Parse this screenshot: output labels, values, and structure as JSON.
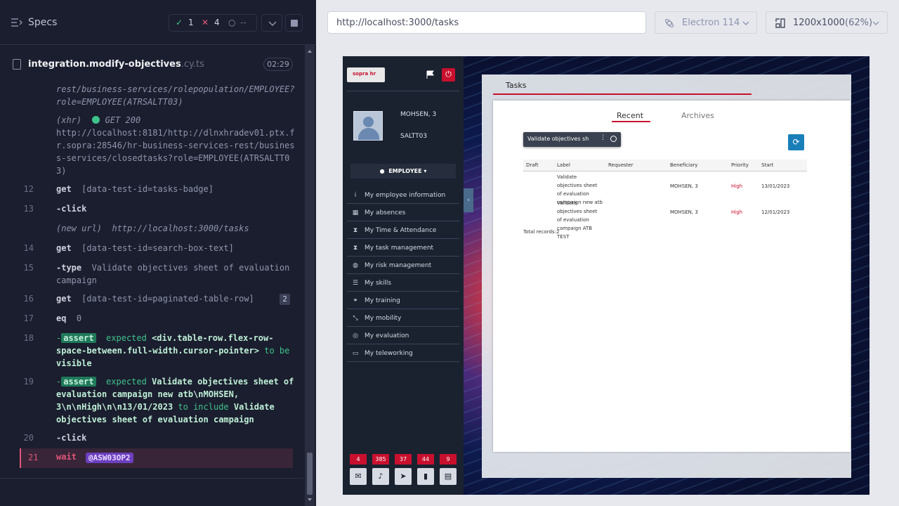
{
  "header": {
    "title": "Specs",
    "passed": "1",
    "failed": "4",
    "pending": "--"
  },
  "spec": {
    "file": "integration.modify-objectives",
    "ext": ".cy.ts",
    "time": "02:29"
  },
  "log": {
    "xhr1": "rest/business-services/rolepopulation/EMPLOYEE?role=EMPLOYEE(ATRSALTT03)",
    "xhr2_tag": "(xhr)",
    "xhr2_status": "GET 200",
    "xhr2_url": "http://localhost:8181/http://dlnxhradev01.ptx.fr.sopra:28546/hr-business-services-rest/business-services/closedtasks?role=EMPLOYEE(ATRSALTT03)",
    "l12_num": "12",
    "l12_cmd": "get",
    "l12_sel": "[data-test-id=tasks-badge]",
    "l13_num": "13",
    "l13_cmd": "-click",
    "newurl_tag": "(new url)",
    "newurl": "http://localhost:3000/tasks",
    "l14_num": "14",
    "l14_cmd": "get",
    "l14_sel": "[data-test-id=search-box-text]",
    "l15_num": "15",
    "l15_cmd": "-type",
    "l15_text": "Validate objectives sheet of evaluation campaign",
    "l16_num": "16",
    "l16_cmd": "get",
    "l16_sel": "[data-test-id=paginated-table-row]",
    "l16_count": "2",
    "l17_num": "17",
    "l17_cmd": "eq",
    "l17_arg": "0",
    "l18_num": "18",
    "l18_tag": "assert",
    "l18_expected": "expected",
    "l18_subject": "<div.table-row.flex-row-space-between.full-width.cursor-pointer>",
    "l18_to": "to be",
    "l18_result": "visible",
    "l19_num": "19",
    "l19_tag": "assert",
    "l19_expected": "expected",
    "l19_subject": "Validate objectives sheet of evaluation campaign new atb\\nMOHSEN, 3\\n\\nHigh\\n\\n13/01/2023",
    "l19_to": "to include",
    "l19_result": "Validate objectives sheet of evaluation campaign",
    "l20_num": "20",
    "l20_cmd": "-click",
    "l21_num": "21",
    "l21_cmd": "wait",
    "l21_alias": "@ASW03OP2"
  },
  "browser": {
    "url": "http://localhost:3000/tasks",
    "engine": "Electron 114",
    "viewport": "1200x1000",
    "zoom": "(62%)"
  },
  "app": {
    "logo": "sopra hr",
    "user": {
      "name": "MOHSEN, 3",
      "id": "SALTT03"
    },
    "role": "EMPLOYEE",
    "menu": [
      {
        "icon": "info-icon",
        "glyph": "i",
        "label": "My employee information"
      },
      {
        "icon": "calendar-icon",
        "glyph": "▦",
        "label": "My absences"
      },
      {
        "icon": "hourglass-icon",
        "glyph": "⧗",
        "label": "My Time & Attendance"
      },
      {
        "icon": "hourglass-icon",
        "glyph": "⧗",
        "label": "My task management"
      },
      {
        "icon": "compass-icon",
        "glyph": "◍",
        "label": "My risk management"
      },
      {
        "icon": "list-icon",
        "glyph": "☰",
        "label": "My skills"
      },
      {
        "icon": "link-icon",
        "glyph": "⚭",
        "label": "My training"
      },
      {
        "icon": "arrows-icon",
        "glyph": "⤡",
        "label": "My mobility"
      },
      {
        "icon": "target-icon",
        "glyph": "◎",
        "label": "My evaluation"
      },
      {
        "icon": "laptop-icon",
        "glyph": "▭",
        "label": "My teleworking"
      }
    ],
    "badges": [
      {
        "count": "4",
        "icon": "mail-icon",
        "glyph": "✉"
      },
      {
        "count": "385",
        "icon": "bell-icon",
        "glyph": "♪"
      },
      {
        "count": "37",
        "icon": "send-icon",
        "glyph": "➤"
      },
      {
        "count": "44",
        "icon": "bookmark-icon",
        "glyph": "▮"
      },
      {
        "count": "9",
        "icon": "document-icon",
        "glyph": "▤"
      }
    ],
    "panel_title": "Tasks",
    "tabs": {
      "recent": "Recent",
      "archives": "Archives"
    },
    "search_value": "Validate objectives sh",
    "columns": [
      "Draft",
      "Label",
      "Requester",
      "Beneficiary",
      "Priority",
      "Start"
    ],
    "rows": [
      {
        "draft": "",
        "label": "Validate objectives sheet of evaluation campaign new atb",
        "requester": "",
        "beneficiary": "MOHSEN, 3",
        "priority": "High",
        "start": "13/01/2023"
      },
      {
        "draft": "",
        "label": "Validate objectives sheet of evaluation campaign ATB TEST",
        "requester": "",
        "beneficiary": "MOHSEN, 3",
        "priority": "High",
        "start": "12/01/2023"
      }
    ],
    "total": "Total records:2"
  }
}
